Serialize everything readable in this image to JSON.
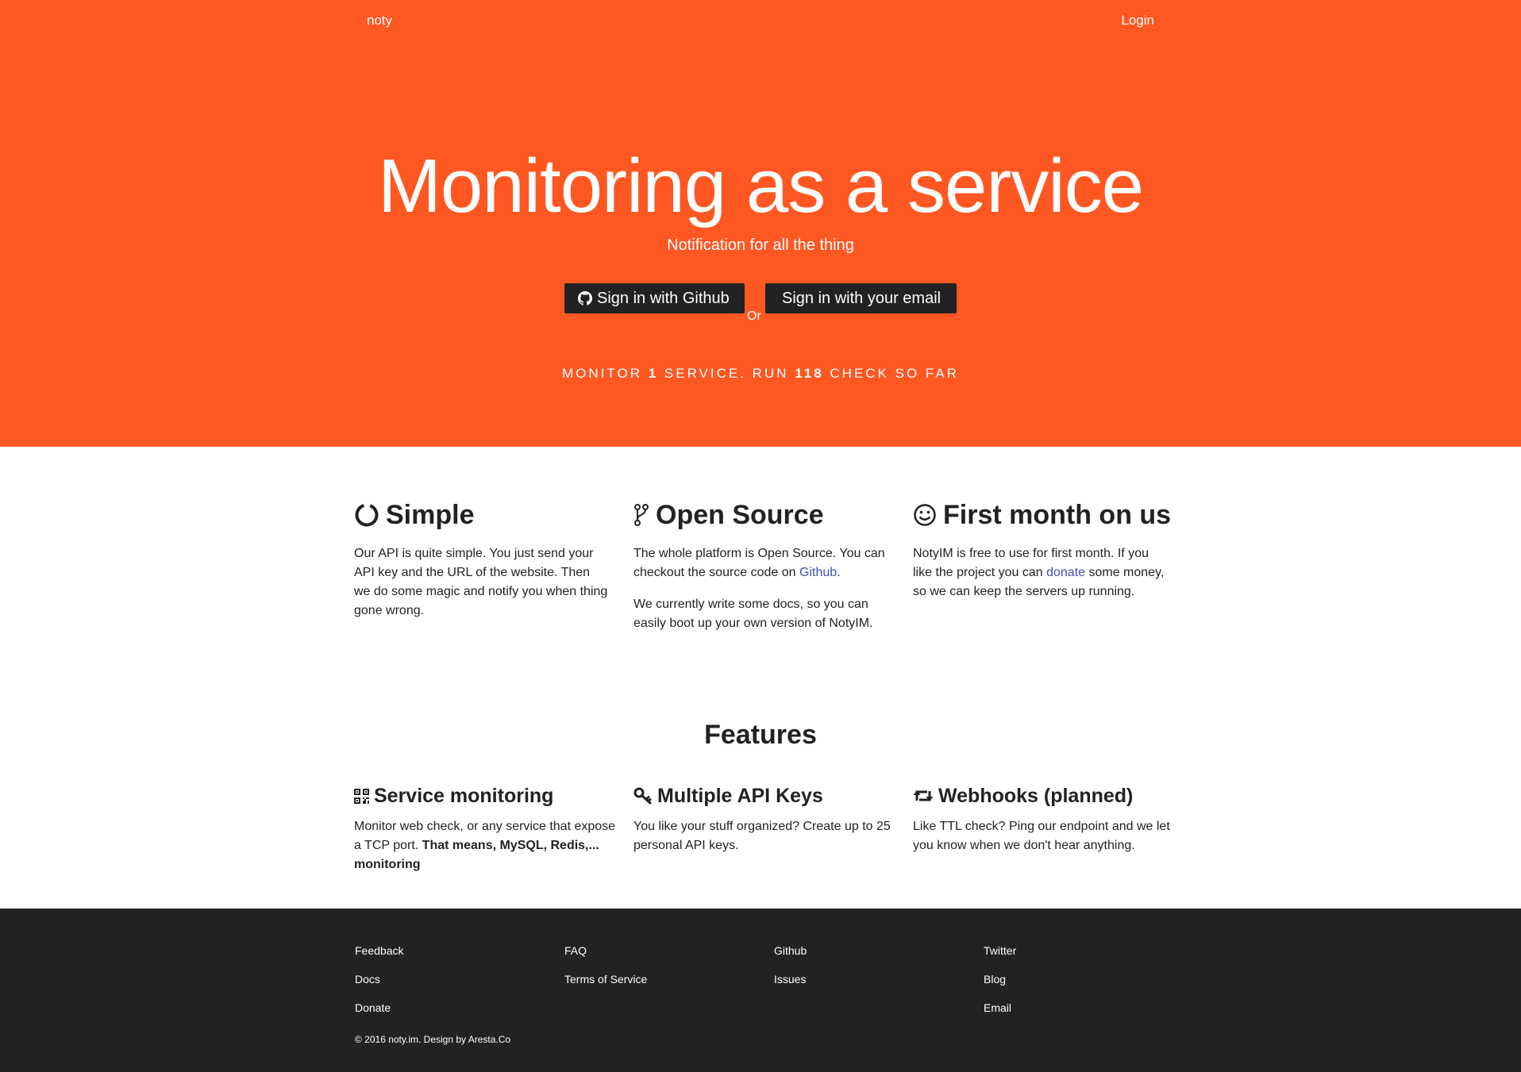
{
  "colors": {
    "brand": "#ff5722",
    "footer_bg": "#222222",
    "link": "#3f51b5"
  },
  "nav": {
    "brand": "noty",
    "login": "Login"
  },
  "hero": {
    "title": "Monitoring as a service",
    "subtitle": "Notification for all the thing",
    "github_button": "Sign in with Github",
    "or_label": "Or",
    "email_button": "Sign in with your email",
    "stats": {
      "prefix": "MONITOR ",
      "services": "1",
      "mid": " SERVICE. RUN ",
      "checks": "118",
      "suffix": " CHECK SO FAR"
    }
  },
  "intro": [
    {
      "icon": "circle-notch-icon",
      "title": "Simple",
      "p1": "Our API is quite simple. You just send your API key and the URL of the website. Then we do some magic and notify you when thing gone wrong."
    },
    {
      "icon": "code-fork-icon",
      "title": "Open Source",
      "p1_before": "The whole platform is Open Source. You can checkout the source code on ",
      "p1_link": "Github",
      "p1_after": ".",
      "p2": "We currently write some docs, so you can easily boot up your own version of NotyIM."
    },
    {
      "icon": "smile-icon",
      "title": "First month on us",
      "p1_before": "NotyIM is free to use for first month. If you like the project you can ",
      "p1_link": "donate",
      "p1_after": " some money, so we can keep the servers up running."
    }
  ],
  "features": {
    "title": "Features",
    "items": [
      {
        "icon": "qrcode-icon",
        "title": "Service monitoring",
        "text": "Monitor web check, or any service that expose a TCP port. ",
        "bold": "That means, MySQL, Redis,... monitoring"
      },
      {
        "icon": "key-icon",
        "title": "Multiple API Keys",
        "text": "You like your stuff organized? Create up to 25 personal API keys."
      },
      {
        "icon": "retweet-icon",
        "title": "Webhooks (planned)",
        "text": "Like TTL check? Ping our endpoint and we let you know when we don't hear anything."
      }
    ]
  },
  "footer": {
    "col1": [
      "Feedback",
      "Docs",
      "Donate"
    ],
    "col2": [
      "FAQ",
      "Terms of Service"
    ],
    "col3": [
      "Github",
      "Issues"
    ],
    "col4": [
      "Twitter",
      "Blog",
      "Email"
    ],
    "copyright": "© 2016 noty.im. Design by Aresta.Co"
  }
}
